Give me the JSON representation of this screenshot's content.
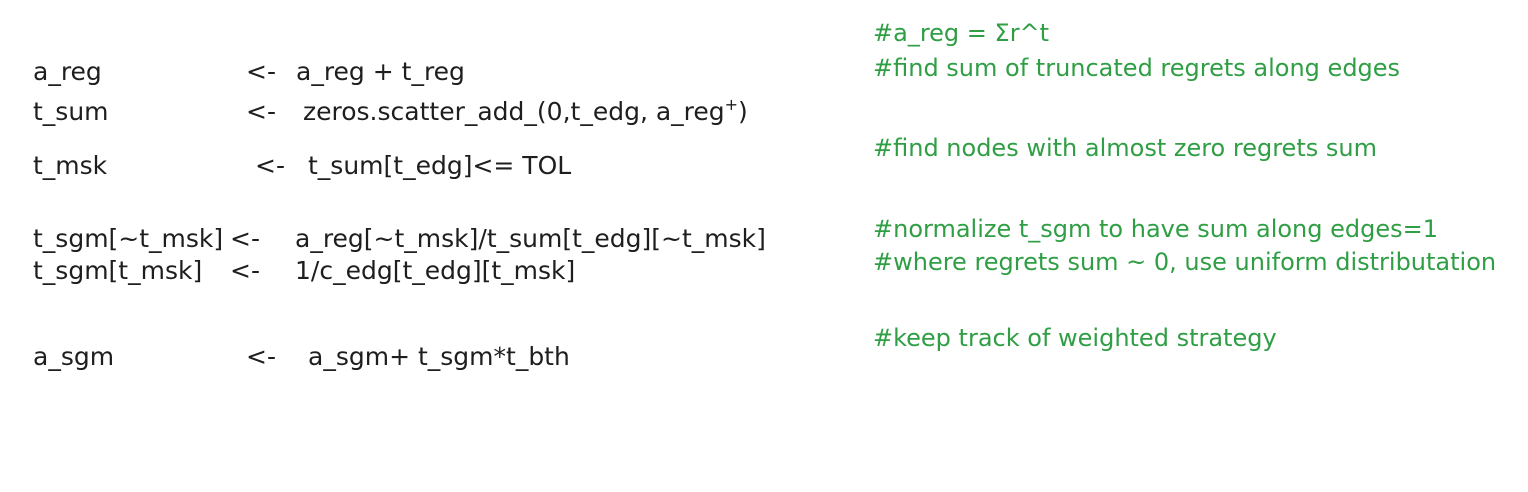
{
  "code_lines": [
    {
      "lhs": "a_reg",
      "arrow": "<-",
      "rhs": "a_reg + t_reg",
      "rhs_sup": ""
    },
    {
      "lhs": "t_sum",
      "arrow": "<-",
      "rhs": "zeros.scatter_add_(0,t_edg, a_reg",
      "rhs_sup": "+",
      "rhs_tail": ")"
    },
    {
      "lhs": "t_msk",
      "arrow": "<-",
      "rhs": "t_sum[t_edg]<= TOL",
      "rhs_sup": ""
    },
    {
      "lhs": "t_sgm[~t_msk]",
      "arrow": "<-",
      "rhs": "a_reg[~t_msk]/t_sum[t_edg][~t_msk]",
      "rhs_sup": ""
    },
    {
      "lhs": "t_sgm[t_msk]",
      "arrow": "<-",
      "rhs": "1/c_edg[t_edg][t_msk]",
      "rhs_sup": ""
    },
    {
      "lhs": "a_sgm",
      "arrow": "<-",
      "rhs": "a_sgm+ t_sgm*t_bth",
      "rhs_sup": ""
    }
  ],
  "comments": [
    "#a_reg = Σr^t",
    "#find sum of truncated regrets along edges",
    "#find nodes with almost zero regrets sum",
    "#normalize t_sgm to have sum along edges=1",
    "#where regrets sum ~ 0, use uniform distributation",
    "#keep track of weighted strategy"
  ],
  "colors": {
    "code": "#1e1e1e",
    "comment": "#2f9e44",
    "background": "#ffffff"
  }
}
